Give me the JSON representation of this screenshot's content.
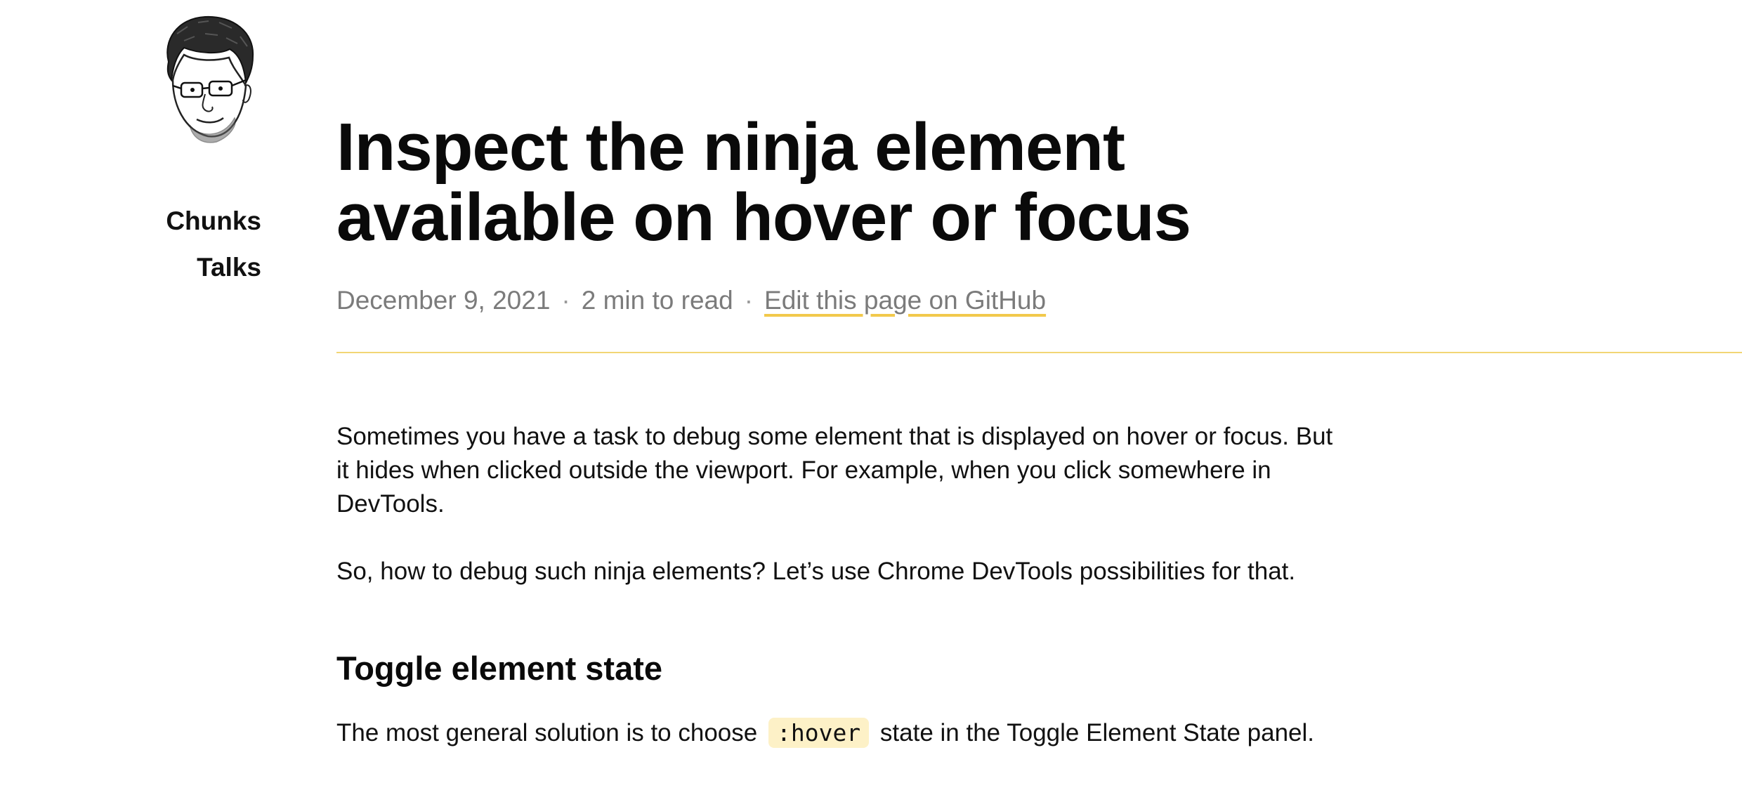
{
  "sidebar": {
    "nav": [
      {
        "label": "Chunks"
      },
      {
        "label": "Talks"
      }
    ]
  },
  "article": {
    "title": "Inspect the ninja element available on hover or focus",
    "meta": {
      "date": "December 9, 2021",
      "separator": "·",
      "read_time": "2 min to read",
      "edit_link": "Edit this page on GitHub"
    },
    "paragraphs": [
      "Sometimes you have a task to debug some element that is displayed on hover or focus. But it hides when clicked outside the viewport. For example, when you click somewhere in DevTools.",
      "So, how to debug such ninja elements? Let’s use Chrome DevTools possibilities for that."
    ],
    "section": {
      "heading": "Toggle element state",
      "text_before_code": "The most general solution is to choose",
      "code": ":hover",
      "text_after_code": "state in the Toggle Element State panel."
    }
  },
  "colors": {
    "accent": "#f2c94c",
    "divider": "#f2d675",
    "code_bg": "#fdf1c7",
    "meta_text": "#7b7b7b"
  }
}
